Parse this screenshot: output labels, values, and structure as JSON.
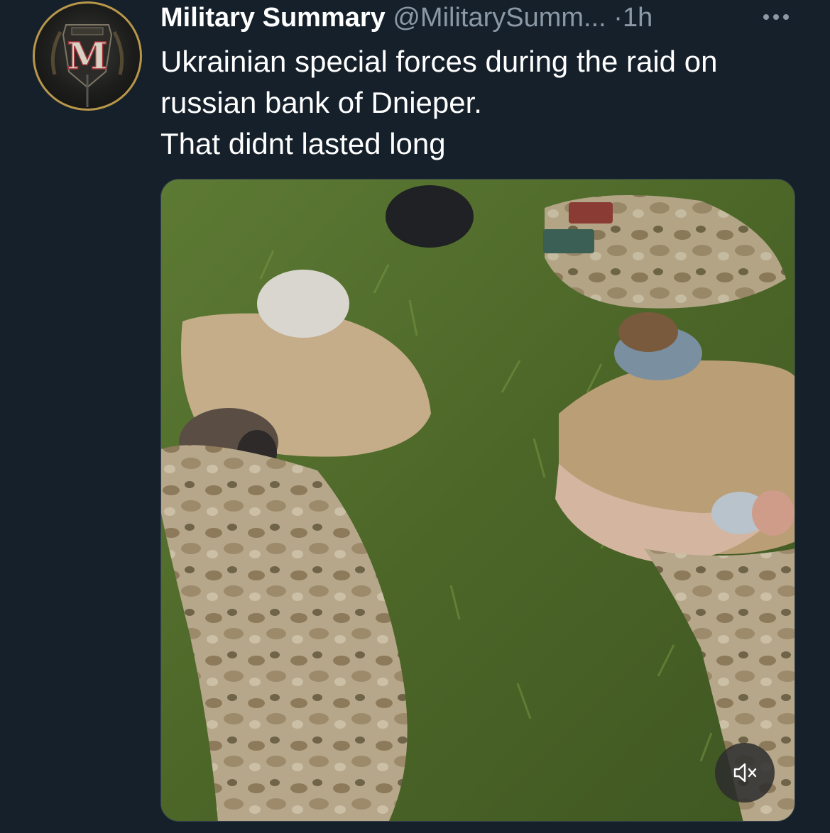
{
  "tweet": {
    "author": {
      "display_name": "Military Summary",
      "handle": "@MilitarySumm...",
      "avatar_icon": "military-summary-logo",
      "avatar_monogram": "M"
    },
    "separator": "·",
    "timestamp": "1h",
    "more_icon": "more-options-icon",
    "text_lines": [
      "Ukrainian special forces during the raid on",
      "russian bank of Dnieper.",
      "That didnt lasted long"
    ],
    "media": {
      "kind": "video",
      "mute_icon": "speaker-muted-icon"
    }
  },
  "colors": {
    "background": "#15202b",
    "primary_text": "#ffffff",
    "secondary_text": "#8b98a5",
    "avatar_ring": "#b8974a"
  }
}
